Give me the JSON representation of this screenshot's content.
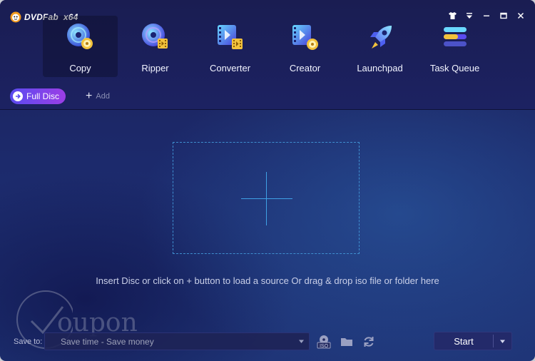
{
  "app": {
    "logo_text": "DVDFab",
    "arch": "x64"
  },
  "window_controls": [
    {
      "name": "skin",
      "icon": "tshirt-icon"
    },
    {
      "name": "menu",
      "icon": "menu-icon"
    },
    {
      "name": "minimize",
      "icon": "minimize-icon"
    },
    {
      "name": "maximize",
      "icon": "maximize-icon"
    },
    {
      "name": "close",
      "icon": "close-icon"
    }
  ],
  "modules": [
    {
      "label": "Copy",
      "icon": "disc-copy-icon",
      "active": true
    },
    {
      "label": "Ripper",
      "icon": "disc-ripper-icon",
      "active": false
    },
    {
      "label": "Converter",
      "icon": "converter-icon",
      "active": false
    },
    {
      "label": "Creator",
      "icon": "creator-icon",
      "active": false
    },
    {
      "label": "Launchpad",
      "icon": "rocket-icon",
      "active": false
    },
    {
      "label": "Task Queue",
      "icon": "task-queue-icon",
      "active": false
    }
  ],
  "subbar": {
    "mode_label": "Full Disc",
    "add_label": "Add"
  },
  "main": {
    "hint": "Insert Disc or click on + button to load a source Or drag & drop iso file or folder here"
  },
  "watermark": {
    "text": "oupon"
  },
  "bottom": {
    "save_to_label": "Save to:",
    "save_path_placeholder": "Save time - Save money",
    "tools": [
      {
        "name": "iso",
        "icon": "iso-icon"
      },
      {
        "name": "folder",
        "icon": "folder-icon"
      },
      {
        "name": "refresh",
        "icon": "refresh-icon"
      }
    ],
    "start_label": "Start"
  },
  "colors": {
    "accent_pill_start": "#5a4bf0",
    "accent_pill_end": "#9b3ee6",
    "dropzone_border": "#3f8fd0",
    "crosshair": "#3fa1e6"
  }
}
